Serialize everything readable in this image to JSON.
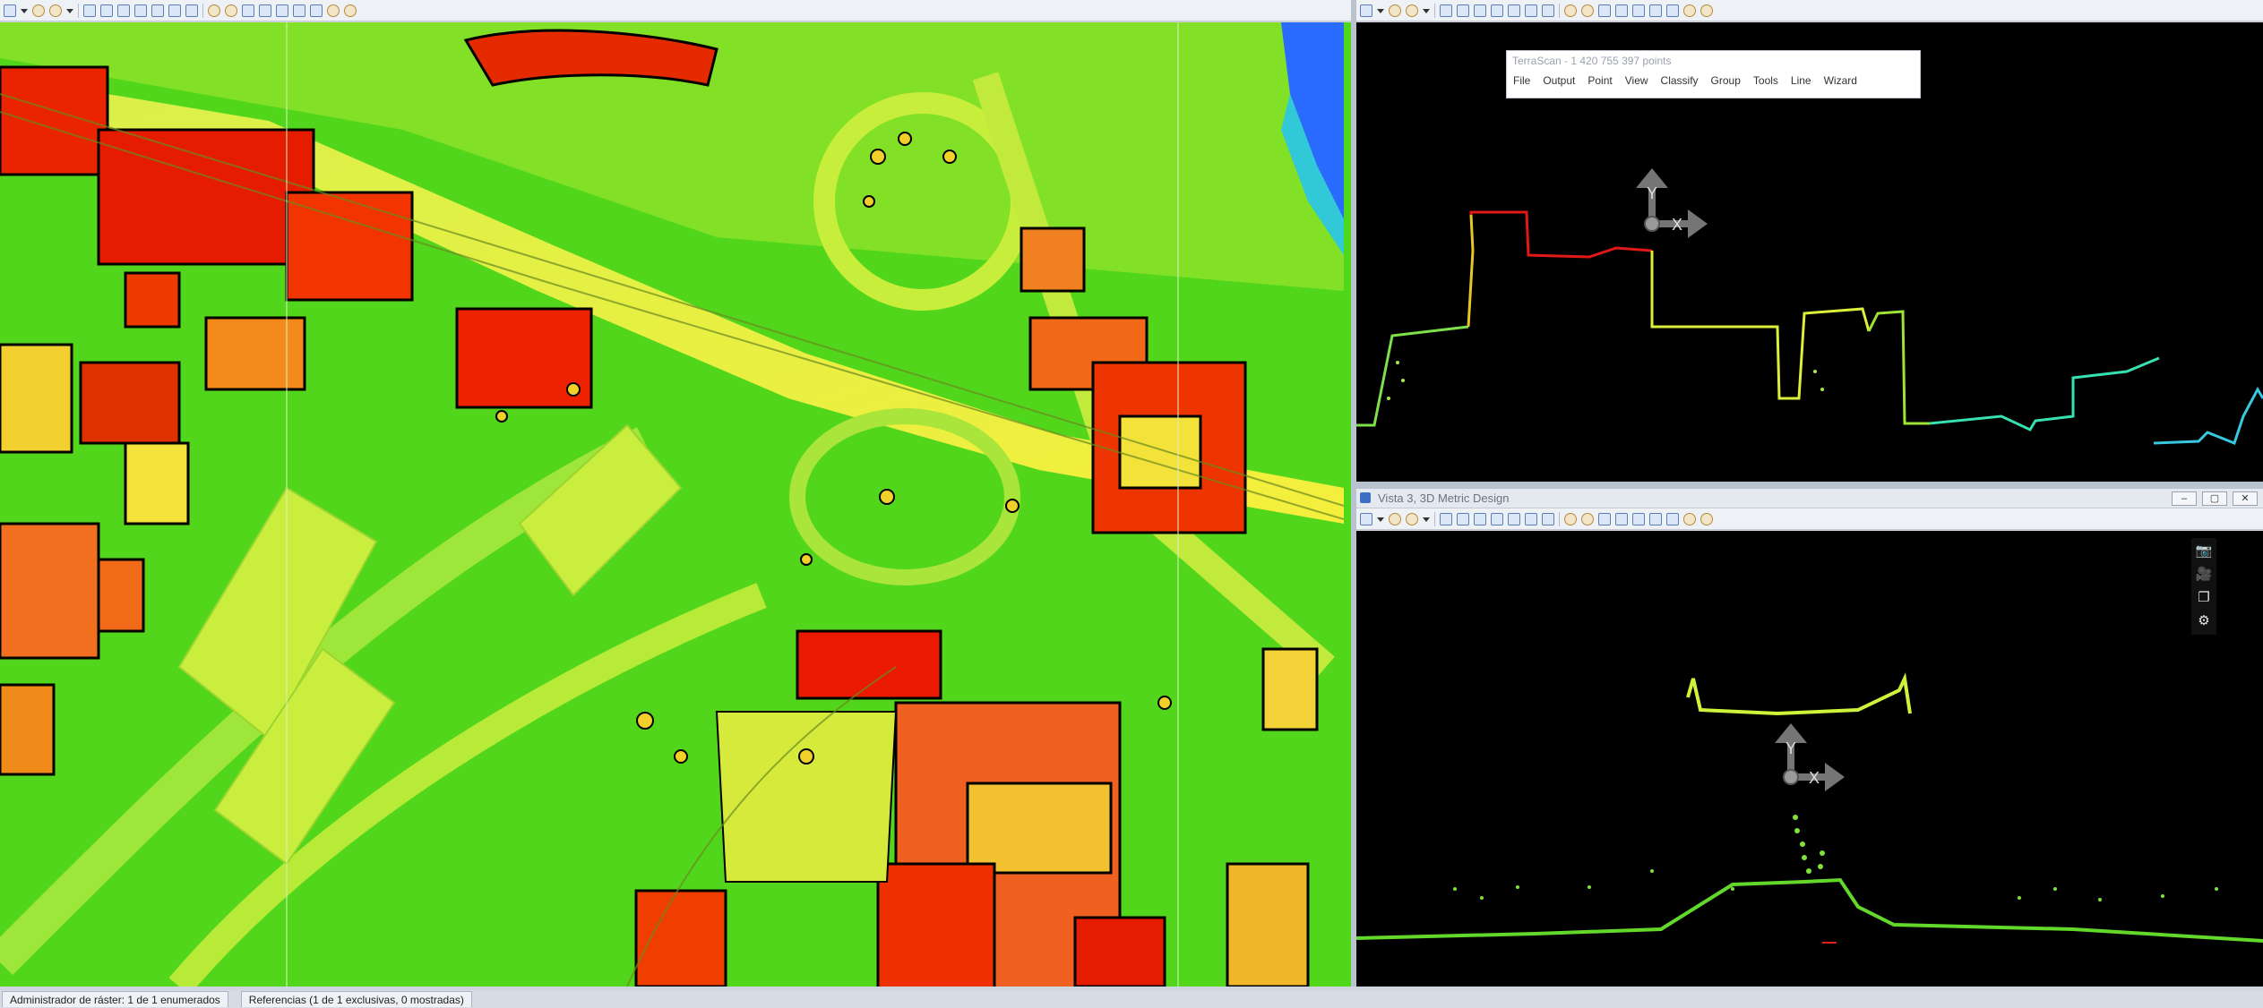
{
  "right_top": {
    "terrascan": {
      "title": "TerraScan - 1 420 755 397 points",
      "menu": [
        "File",
        "Output",
        "Point",
        "View",
        "Classify",
        "Group",
        "Tools",
        "Line",
        "Wizard"
      ]
    },
    "axes": {
      "y_label": "Y",
      "x_label": "X"
    }
  },
  "right_bottom": {
    "title": "Vista 3, 3D Metric Design",
    "window_buttons": {
      "minimize": "‒",
      "maximize": "▢",
      "close": "✕"
    },
    "axes": {
      "y_label": "Y",
      "x_label": "X"
    },
    "side_tools": {
      "camera": "📷",
      "video": "🎥",
      "layers": "❐",
      "settings": "⚙"
    }
  },
  "statusbar": {
    "raster_manager": "Administrador de ráster: 1 de 1 enumerados",
    "references": "Referencias (1 de 1 exclusivas, 0 mostradas)"
  }
}
